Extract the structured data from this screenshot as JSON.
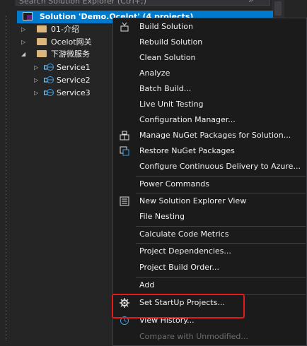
{
  "search": {
    "placeholder": "Search Solution Explorer (Ctrl+;)"
  },
  "tree": {
    "solution_label": "Solution 'Demo.Ocelot' (4 projects)",
    "items": [
      {
        "label": "01-介绍"
      },
      {
        "label": "Ocelot网关"
      },
      {
        "label": "下游微服务"
      },
      {
        "label": "Service1"
      },
      {
        "label": "Service2"
      },
      {
        "label": "Service3"
      }
    ]
  },
  "context_menu": {
    "items": [
      {
        "label": "Build Solution",
        "icon": "build-icon"
      },
      {
        "label": "Rebuild Solution"
      },
      {
        "label": "Clean Solution"
      },
      {
        "label": "Analyze"
      },
      {
        "label": "Batch Build..."
      },
      {
        "label": "Live Unit Testing"
      },
      {
        "label": "Configuration Manager..."
      },
      {
        "label": "Manage NuGet Packages for Solution...",
        "icon": "nuget-icon"
      },
      {
        "label": "Restore NuGet Packages",
        "icon": "restore-icon"
      },
      {
        "label": "Configure Continuous Delivery to Azure..."
      },
      {
        "label": "Power Commands"
      },
      {
        "label": "New Solution Explorer View",
        "icon": "new-view-icon"
      },
      {
        "label": "File Nesting"
      },
      {
        "label": "Calculate Code Metrics"
      },
      {
        "label": "Project Dependencies..."
      },
      {
        "label": "Project Build Order..."
      },
      {
        "label": "Add"
      },
      {
        "label": "Set StartUp Projects...",
        "icon": "gear-icon"
      },
      {
        "label": "View History...",
        "icon": "history-icon"
      },
      {
        "label": "Compare with Unmodified..."
      }
    ]
  },
  "colors": {
    "selection": "#007acc",
    "highlight_box": "#e51b1b",
    "menu_bg": "#1b1b1c"
  }
}
